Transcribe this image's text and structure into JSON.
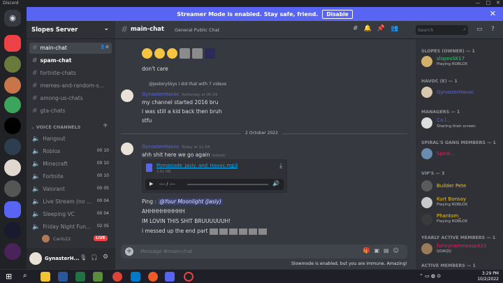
{
  "app": {
    "title": "Discord"
  },
  "banner": {
    "text": "Streamer Mode is enabled. Stay safe, friend.",
    "button": "Disable"
  },
  "server": {
    "name": "Slopes Server"
  },
  "channels": [
    {
      "name": "main-chat",
      "state": "selected"
    },
    {
      "name": "spam-chat",
      "state": "unread"
    },
    {
      "name": "fortnite-chats",
      "state": "normal"
    },
    {
      "name": "memes-and-random-s...",
      "state": "normal"
    },
    {
      "name": "among-us-chats",
      "state": "normal"
    },
    {
      "name": "gta-chats",
      "state": "normal"
    }
  ],
  "voice_category": "VOICE CHANNELS",
  "voice_channels": [
    {
      "name": "Hangout",
      "count": ""
    },
    {
      "name": "Roblox",
      "count": "00 10"
    },
    {
      "name": "Minecraft",
      "count": "00 10"
    },
    {
      "name": "Fortnite",
      "count": "00 10"
    },
    {
      "name": "Valorant",
      "count": "00 05"
    },
    {
      "name": "Live Stream (no ...",
      "count": "00 04"
    },
    {
      "name": "Sleeping VC",
      "count": "00 04"
    },
    {
      "name": "Friday Night Fun...",
      "count": "02 05"
    }
  ],
  "voice_user": {
    "name": "Carlo22",
    "badge": "LIVE"
  },
  "user": {
    "name": "GynasterH..."
  },
  "chat": {
    "channel": "main-chat",
    "topic": "General Public Chat",
    "search_placeholder": "Search"
  },
  "messages": {
    "m1_text": "don't care",
    "reply_to": "@JesterySkys",
    "reply_text": "I did that with 7 videos",
    "m2_user": "GynasterHavoc",
    "m2_time": "Yesterday at 06:59",
    "m2_lines": [
      "my channel started 2016 bru",
      "i was still a kid back then bruh",
      "stfu"
    ],
    "date_divider": "2 October 2022",
    "m3_user": "GynasterHavoc",
    "m3_time": "Today at 11:54",
    "m3_line1": "ahh shit here we go again",
    "m3_edited": "(edited)",
    "attachment": {
      "file": "Pomenade_Jasiy_and_Havoc.mp3",
      "size": "3.91 MB",
      "time": "-:-- / -:--"
    },
    "ping_prefix": "Ping : ",
    "ping_mention": "@Your Moonlight (Jasiy)",
    "m3_line3": "AHHHHHHHHHH",
    "m3_line4": "IM LOVIN THIS SHIT BRUUUUUUH!",
    "m3_line5": "i messed up the end part"
  },
  "input": {
    "placeholder": "Message #main-chat"
  },
  "slowmode": "Slowmode is enabled, but you are immune. Amazing!",
  "members": [
    {
      "category": "SLOPES (OWNER) — 1"
    },
    {
      "name": "slopesSK17",
      "status": "Playing ROBLOX",
      "color": "#2ecc71"
    },
    {
      "category": "HAVOC (E) — 1"
    },
    {
      "name": "GynasterHavoc",
      "status": "",
      "color": "#5865f2"
    },
    {
      "category": "MANAGERS — 1"
    },
    {
      "name": "Ca.l...",
      "status": "Sharing their screen",
      "color": "#5865f2"
    },
    {
      "category": "SPIRAL'S GANG MEMBERS — 1"
    },
    {
      "name": "Spiral...",
      "status": "",
      "color": "#e91e63"
    },
    {
      "category": "VIP'S — 3"
    },
    {
      "name": "Builder Pete",
      "status": "",
      "color": "#f1c40f"
    },
    {
      "name": "Kurt Bonsay",
      "status": "Playing ROBLOX",
      "color": "#f1c40f"
    },
    {
      "name": "Phantom_",
      "status": "Playing ROBLOX",
      "color": "#f1c40f"
    },
    {
      "category": "YEARLY ACTIVE MEMBERS — 1"
    },
    {
      "name": "funnynamewasp423",
      "status": "QOAQQ",
      "color": "#e91e63"
    },
    {
      "category": "ACTIVE MEMBERS — 1"
    }
  ],
  "clock": {
    "time": "3:29 PM",
    "date": "10/2/2022"
  }
}
